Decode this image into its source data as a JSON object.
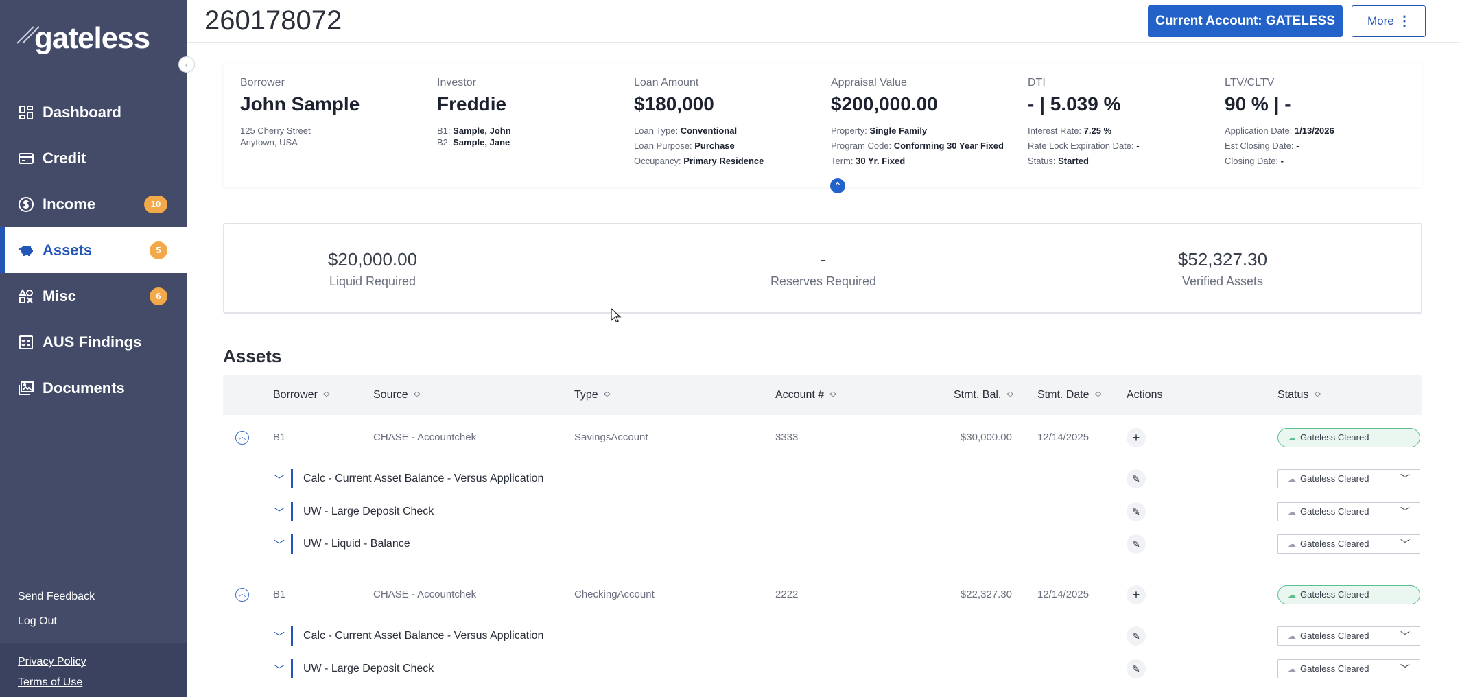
{
  "app": {
    "logo_text": "gateless",
    "loan_number": "260178072",
    "current_account_label": "Current Account: GATELESS",
    "more_label": "More"
  },
  "sidebar": {
    "items": [
      {
        "label": "Dashboard",
        "icon": "dashboard-icon",
        "badge": null,
        "active": false
      },
      {
        "label": "Credit",
        "icon": "credit-card-icon",
        "badge": null,
        "active": false
      },
      {
        "label": "Income",
        "icon": "dollar-icon",
        "badge": "10",
        "active": false
      },
      {
        "label": "Assets",
        "icon": "piggy-bank-icon",
        "badge": "5",
        "active": true
      },
      {
        "label": "Misc",
        "icon": "shapes-icon",
        "badge": "6",
        "active": false
      },
      {
        "label": "AUS Findings",
        "icon": "checklist-icon",
        "badge": null,
        "active": false
      },
      {
        "label": "Documents",
        "icon": "images-icon",
        "badge": null,
        "active": false
      }
    ],
    "send_feedback": "Send Feedback",
    "log_out": "Log Out",
    "privacy_policy": "Privacy Policy",
    "terms_of_use": "Terms of Use"
  },
  "summary": {
    "borrower": {
      "label": "Borrower",
      "value": "John Sample",
      "line1": "125 Cherry Street",
      "line2": "Anytown, USA"
    },
    "investor": {
      "label": "Investor",
      "value": "Freddie",
      "b1_label": "B1:",
      "b1": "Sample, John",
      "b2_label": "B2:",
      "b2": "Sample, Jane"
    },
    "loan_amount": {
      "label": "Loan Amount",
      "value": "$180,000",
      "type_label": "Loan Type:",
      "type": "Conventional",
      "purpose_label": "Loan Purpose:",
      "purpose": "Purchase",
      "occupancy_label": "Occupancy:",
      "occupancy": "Primary Residence"
    },
    "appraisal": {
      "label": "Appraisal Value",
      "value": "$200,000.00",
      "property_label": "Property:",
      "property": "Single Family",
      "program_label": "Program Code:",
      "program": "Conforming 30 Year Fixed",
      "term_label": "Term:",
      "term": "30 Yr. Fixed"
    },
    "dti": {
      "label": "DTI",
      "value": "- | 5.039 %",
      "rate_label": "Interest Rate:",
      "rate": "7.25 %",
      "lock_label": "Rate Lock Expiration Date:",
      "lock": "-",
      "status_label": "Status:",
      "status": "Started"
    },
    "ltv": {
      "label": "LTV/CLTV",
      "value": "90 % | -",
      "app_date_label": "Application Date:",
      "app_date": "1/13/2026",
      "est_close_label": "Est Closing Date:",
      "est_close": "-",
      "close_label": "Closing Date:",
      "close": "-"
    }
  },
  "totals": {
    "liquid": {
      "value": "$20,000.00",
      "label": "Liquid Required"
    },
    "reserves": {
      "value": "-",
      "label": "Reserves Required"
    },
    "verified": {
      "value": "$52,327.30",
      "label": "Verified Assets"
    }
  },
  "assets": {
    "title": "Assets",
    "columns": {
      "borrower": "Borrower",
      "source": "Source",
      "type": "Type",
      "account": "Account #",
      "stmt_bal": "Stmt. Bal.",
      "stmt_date": "Stmt. Date",
      "actions": "Actions",
      "status": "Status"
    },
    "rows": [
      {
        "borrower": "B1",
        "source": "CHASE - Accountchek",
        "type": "SavingsAccount",
        "account": "3333",
        "stmt_bal": "$30,000.00",
        "stmt_date": "12/14/2025",
        "status": "Gateless Cleared",
        "checks": [
          {
            "label": "Calc - Current Asset Balance - Versus Application",
            "status": "Gateless Cleared"
          },
          {
            "label": "UW - Large Deposit Check",
            "status": "Gateless Cleared"
          },
          {
            "label": "UW - Liquid - Balance",
            "status": "Gateless Cleared"
          }
        ]
      },
      {
        "borrower": "B1",
        "source": "CHASE - Accountchek",
        "type": "CheckingAccount",
        "account": "2222",
        "stmt_bal": "$22,327.30",
        "stmt_date": "12/14/2025",
        "status": "Gateless Cleared",
        "checks": [
          {
            "label": "Calc - Current Asset Balance - Versus Application",
            "status": "Gateless Cleared"
          },
          {
            "label": "UW - Large Deposit Check",
            "status": "Gateless Cleared"
          }
        ]
      }
    ]
  },
  "colors": {
    "sidebar": "#444b69",
    "accent": "#2362c9",
    "badge": "#f1a94a",
    "cleared": "#5bbf8f"
  }
}
